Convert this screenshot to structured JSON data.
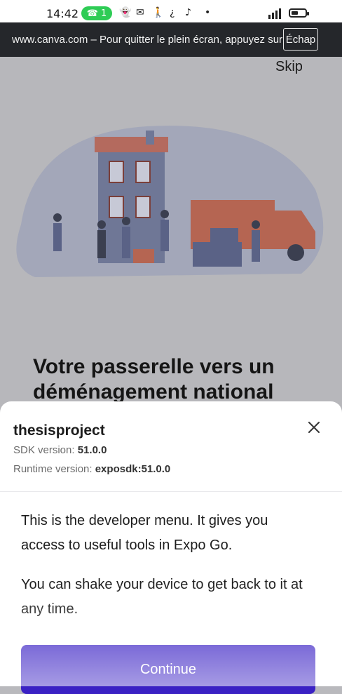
{
  "status_bar": {
    "time": "14:42",
    "call_count": "1",
    "icons": [
      "call-icon",
      "snapchat-icon",
      "messenger-icon",
      "walking-icon",
      "question-icon",
      "tiktok-icon",
      "dot-icon",
      "signal-icon",
      "battery-icon"
    ]
  },
  "fullscreen_banner": {
    "text": "www.canva.com – Pour quitter le plein écran, appuyez sur",
    "exit_key": "Échap"
  },
  "background_app": {
    "skip_label": "Skip",
    "headline": "Votre passerelle vers un déménagement national"
  },
  "dev_menu": {
    "project_name": "thesisproject",
    "sdk_label": "SDK version:",
    "sdk_value": "51.0.0",
    "runtime_label": "Runtime version:",
    "runtime_value": "exposdk:51.0.0",
    "paragraph1": "This is the developer menu. It gives you access to useful tools in Expo Go.",
    "paragraph2": "You can shake your device to get back to it at any time.",
    "continue_label": "Continue"
  },
  "colors": {
    "continue_button": "#3a21c4",
    "call_pill": "#2ecc55",
    "banner": "#25272b"
  }
}
